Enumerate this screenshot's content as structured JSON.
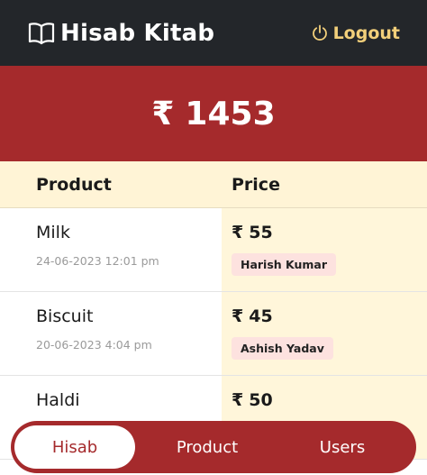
{
  "header": {
    "title": "Hisab Kitab",
    "brand_icon": "book-icon",
    "logout_label": "Logout",
    "logout_icon": "power-icon"
  },
  "total": {
    "currency": "₹",
    "amount": "1453"
  },
  "table": {
    "columns": [
      "Product",
      "Price"
    ],
    "rows": [
      {
        "product": "Milk",
        "date": "24-06-2023 12:01 pm",
        "currency": "₹",
        "price": "55",
        "user": "Harish Kumar"
      },
      {
        "product": "Biscuit",
        "date": "20-06-2023 4:04 pm",
        "currency": "₹",
        "price": "45",
        "user": "Ashish Yadav"
      },
      {
        "product": "Haldi",
        "date": "",
        "currency": "₹",
        "price": "50",
        "user": ""
      }
    ]
  },
  "nav": {
    "items": [
      {
        "label": "Hisab",
        "active": true
      },
      {
        "label": "Product",
        "active": false
      },
      {
        "label": "Users",
        "active": false
      }
    ]
  },
  "colors": {
    "header_bg": "#23262a",
    "accent": "#a52a2c",
    "logout": "#f2cf7a",
    "table_header_bg": "#fff4d6",
    "price_cell_bg": "#fff6da",
    "user_badge_bg": "#fde2df"
  }
}
